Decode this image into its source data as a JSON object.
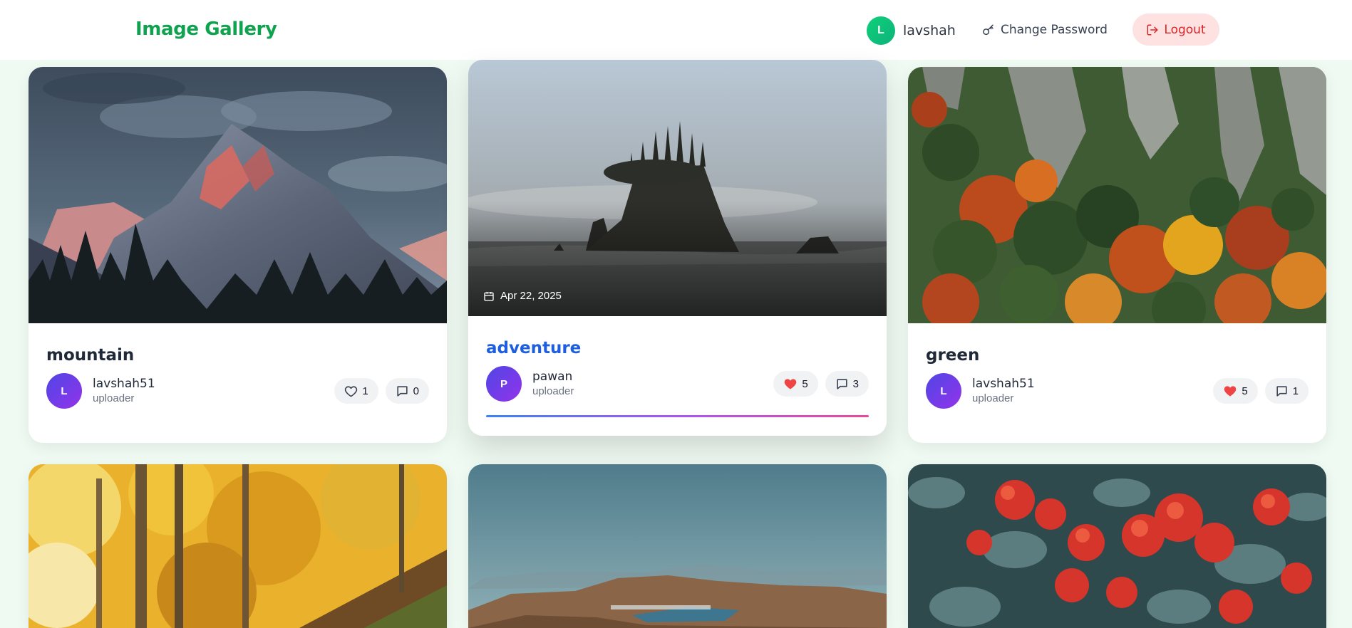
{
  "header": {
    "brand": "Image Gallery",
    "user_initial": "L",
    "username": "lavshah",
    "change_password_label": "Change Password",
    "logout_label": "Logout"
  },
  "cards": [
    {
      "title": "mountain",
      "owner_initial": "L",
      "owner": "lavshah51",
      "role": "uploader",
      "likes": "1",
      "liked": false,
      "comments": "0"
    },
    {
      "title": "adventure",
      "owner_initial": "P",
      "owner": "pawan",
      "role": "uploader",
      "likes": "5",
      "liked": true,
      "comments": "3",
      "date": "Apr 22, 2025"
    },
    {
      "title": "green",
      "owner_initial": "L",
      "owner": "lavshah51",
      "role": "uploader",
      "likes": "5",
      "liked": true,
      "comments": "1"
    }
  ],
  "colors": {
    "brand": "#10a34f",
    "page_bg": "#effaf2",
    "title_active": "#1d5fe0",
    "heart_liked": "#ef4444",
    "logout_bg": "#fee2e2",
    "logout_text": "#dc2626"
  },
  "icons": [
    "key-icon",
    "logout-icon",
    "heart-icon",
    "comment-icon",
    "calendar-icon"
  ]
}
